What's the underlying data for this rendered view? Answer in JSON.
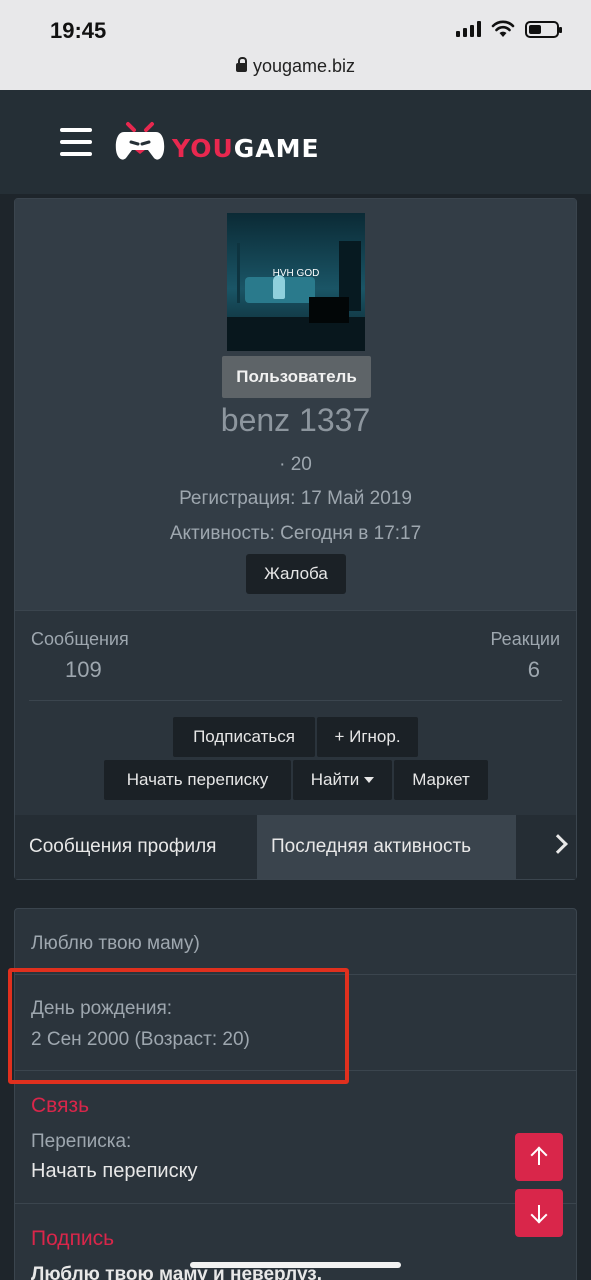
{
  "status_bar": {
    "time": "19:45",
    "url": "yougame.biz"
  },
  "header": {
    "logo_you": "YOU",
    "logo_game": "GAME",
    "logo_color": "#e8284f"
  },
  "profile": {
    "avatar_caption": "HVH GOD",
    "role": "Пользователь",
    "username": "benz 1337",
    "dot_line": "· 20",
    "registration": "Регистрация: 17 Май 2019",
    "activity": "Активность: Сегодня в 17:17",
    "report_label": "Жалоба"
  },
  "stats": {
    "messages_label": "Сообщения",
    "messages_value": "109",
    "reactions_label": "Реакции",
    "reactions_value": "6"
  },
  "actions": {
    "subscribe": "Подписаться",
    "ignore": "+ Игнор.",
    "start_conversation": "Начать переписку",
    "find": "Найти",
    "market": "Маркет"
  },
  "tabs": [
    {
      "label": "Сообщения профиля"
    },
    {
      "label": "Последняя активность"
    }
  ],
  "about": {
    "status_text": "Люблю твою маму)",
    "birthday_label": "День рождения:",
    "birthday_value": "2 Сен 2000 (Возраст: 20)",
    "contact_title": "Связь",
    "conversation_label": "Переписка:",
    "conversation_link": "Начать переписку",
    "signature_title": "Подпись",
    "signature_text": "Люблю твою маму и неверлуз."
  },
  "colors": {
    "accent": "#d9264a",
    "highlight": "#e0301e"
  }
}
